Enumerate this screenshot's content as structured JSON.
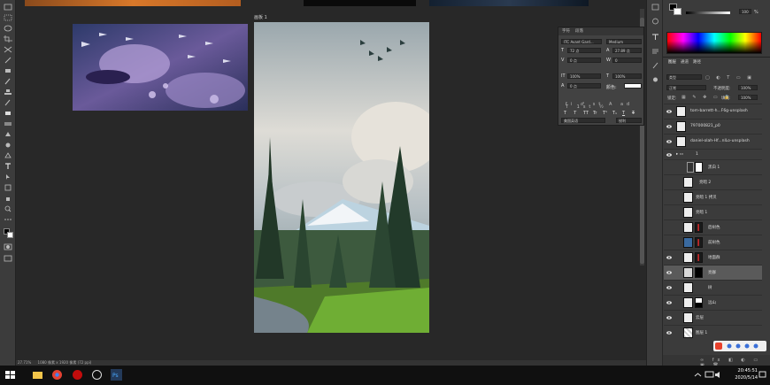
{
  "artboard": {
    "label": "画板 1"
  },
  "status": {
    "zoom": "27.71%",
    "doc_info": "1080 像素 x 1920 像素 (72 ppi)"
  },
  "character_panel": {
    "tabs": [
      "字符",
      "段落"
    ],
    "font_family": "ITC Avant Gard...",
    "font_style": "Medium",
    "font_size": "72 点",
    "leading": "27.89 点",
    "kerning": "0 点",
    "tracking": "0",
    "vscale": "100%",
    "hscale": "100%",
    "baseline": "0 点",
    "color_label": "颜色:",
    "type_buttons": [
      "T",
      "T",
      "TT",
      "Tr",
      "T¹",
      "T₁",
      "T",
      "T"
    ],
    "language": "美国英语",
    "antialias": "锐利"
  },
  "color_panel": {
    "value": "100",
    "unit": "%"
  },
  "layers_panel": {
    "tabs": [
      "图层",
      "通道",
      "路径"
    ],
    "filter": "类型",
    "blend_mode": "正常",
    "opacity_label": "不透明度:",
    "opacity": "100%",
    "lock_label": "锁定:",
    "fill_label": "填充:",
    "fill": "100%",
    "layers": [
      {
        "name": "tom-barrett-h...F6g-unsplash",
        "selected": false
      },
      {
        "name": "797000821_p0",
        "selected": false
      },
      {
        "name": "daniel-olah-Hf...nlLo-unsplash",
        "selected": false
      },
      {
        "name": "1",
        "selected": false
      },
      {
        "name": "黑白 1",
        "selected": false
      },
      {
        "name": "亮暗 2",
        "selected": false
      },
      {
        "name": "亮暗 1 拷贝",
        "selected": false
      },
      {
        "name": "亮暗 1",
        "selected": false
      },
      {
        "name": "后树色",
        "selected": false
      },
      {
        "name": "前树色",
        "selected": false
      },
      {
        "name": "地面群",
        "selected": false
      },
      {
        "name": "亮群",
        "selected": true
      },
      {
        "name": "树",
        "selected": false
      },
      {
        "name": "远山",
        "selected": false
      },
      {
        "name": "云层",
        "selected": false
      },
      {
        "name": "图层 1",
        "selected": false
      }
    ]
  },
  "taskbar": {
    "time": "20:45:51",
    "date": "2020/5/14"
  },
  "colors": {
    "accent_red": "#d62b2b",
    "panel_bg": "#3b3b3b",
    "selected_row": "#5a5a5a"
  }
}
